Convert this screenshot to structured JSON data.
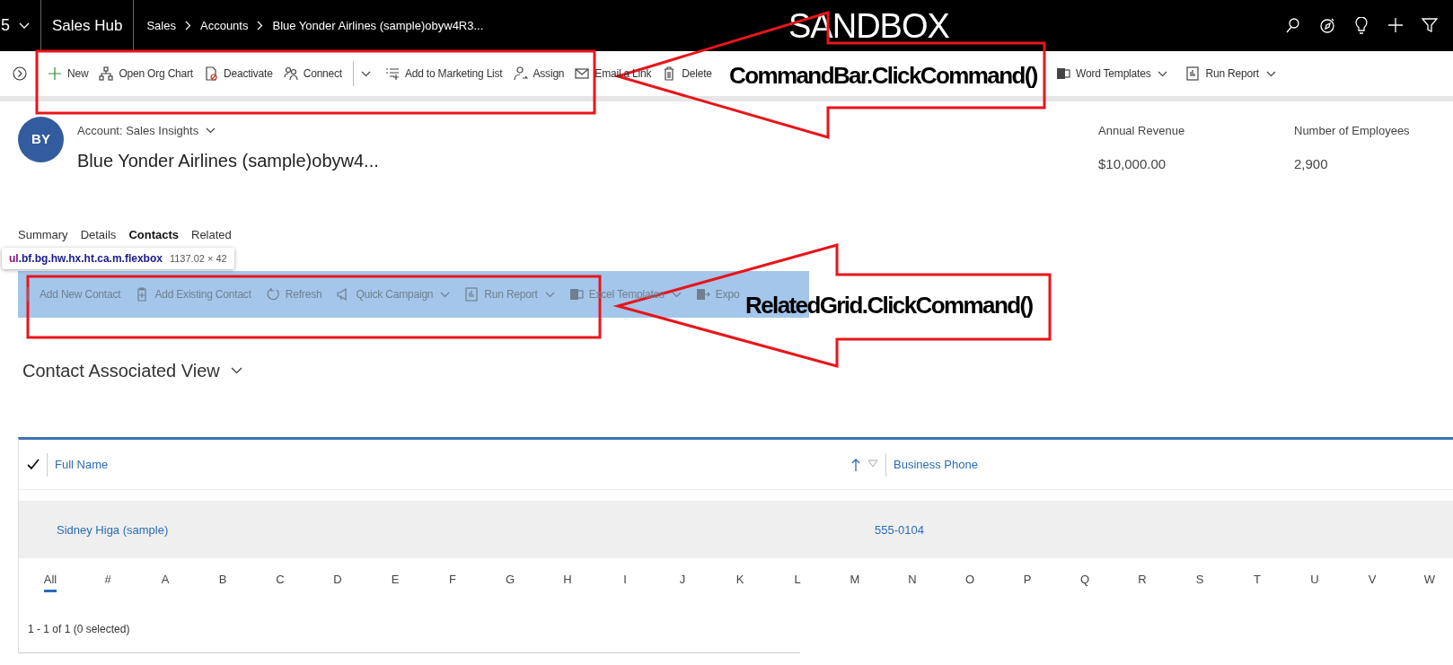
{
  "top_bar": {
    "app_switcher": "5",
    "app_name": "Sales Hub",
    "breadcrumbs": [
      "Sales",
      "Accounts",
      "Blue Yonder Airlines (sample)obyw4R3..."
    ],
    "environment": "SANDBOX"
  },
  "command_bar": {
    "items": [
      {
        "kind": "new",
        "label": "New",
        "menu": false
      },
      {
        "kind": "org-chart",
        "label": "Open Org Chart",
        "menu": false
      },
      {
        "kind": "deactivate",
        "label": "Deactivate",
        "menu": false
      },
      {
        "kind": "connect",
        "label": "Connect",
        "menu": true
      },
      {
        "kind": "marketing-list",
        "label": "Add to Marketing List",
        "menu": false
      },
      {
        "kind": "assign",
        "label": "Assign",
        "menu": false
      },
      {
        "kind": "email-link",
        "label": "Email a Link",
        "menu": false
      },
      {
        "kind": "delete",
        "label": "Delete",
        "menu": false
      },
      {
        "kind": "word",
        "label": "Word Templates",
        "menu": true
      },
      {
        "kind": "report",
        "label": "Run Report",
        "menu": true
      }
    ]
  },
  "record": {
    "initials": "BY",
    "form": "Account: Sales Insights",
    "name": "Blue Yonder Airlines (sample)obyw4...",
    "fields": [
      {
        "label": "Annual Revenue",
        "value": "$10,000.00"
      },
      {
        "label": "Number of Employees",
        "value": "2,900"
      }
    ]
  },
  "tabs": [
    {
      "label": "Summary",
      "selected": false
    },
    {
      "label": "Details",
      "selected": false
    },
    {
      "label": "Contacts",
      "selected": true
    },
    {
      "label": "Related",
      "selected": false
    }
  ],
  "inspector_tooltip": {
    "tag": "ul",
    "classes": ".bf.bg.hw.hx.ht.ca.m.flexbox",
    "size": "1137.02 × 42"
  },
  "related_grid": {
    "commands": [
      {
        "kind": "add-new",
        "label": "Add New Contact",
        "menu": false
      },
      {
        "kind": "add-existing",
        "label": "Add Existing Contact",
        "menu": false
      },
      {
        "kind": "refresh",
        "label": "Refresh",
        "menu": false
      },
      {
        "kind": "campaign",
        "label": "Quick Campaign",
        "menu": true
      },
      {
        "kind": "report",
        "label": "Run Report",
        "menu": true
      },
      {
        "kind": "excel",
        "label": "Excel Templates",
        "menu": true
      },
      {
        "kind": "export",
        "label": "Expo",
        "menu": false
      }
    ],
    "view_title": "Contact Associated View",
    "columns": [
      {
        "label": "Full Name",
        "sorted": true
      },
      {
        "label": "Business Phone",
        "sorted": false
      }
    ],
    "rows": [
      {
        "cells": [
          "Sidney Higa (sample)",
          "555-0104"
        ]
      }
    ],
    "jump_bar": [
      {
        "label": "All",
        "selected": true
      },
      {
        "label": "#",
        "selected": false
      },
      {
        "label": "A",
        "selected": false
      },
      {
        "label": "B",
        "selected": false
      },
      {
        "label": "C",
        "selected": false
      },
      {
        "label": "D",
        "selected": false
      },
      {
        "label": "E",
        "selected": false
      },
      {
        "label": "F",
        "selected": false
      },
      {
        "label": "G",
        "selected": false
      },
      {
        "label": "H",
        "selected": false
      },
      {
        "label": "I",
        "selected": false
      },
      {
        "label": "J",
        "selected": false
      },
      {
        "label": "K",
        "selected": false
      },
      {
        "label": "L",
        "selected": false
      },
      {
        "label": "M",
        "selected": false
      },
      {
        "label": "N",
        "selected": false
      },
      {
        "label": "O",
        "selected": false
      },
      {
        "label": "P",
        "selected": false
      },
      {
        "label": "Q",
        "selected": false
      },
      {
        "label": "R",
        "selected": false
      },
      {
        "label": "S",
        "selected": false
      },
      {
        "label": "T",
        "selected": false
      },
      {
        "label": "U",
        "selected": false
      },
      {
        "label": "V",
        "selected": false
      },
      {
        "label": "W",
        "selected": false
      }
    ],
    "footer": "1 - 1 of 1 (0 selected)"
  },
  "annotations": [
    {
      "text": "CommandBar.ClickCommand()"
    },
    {
      "text": "RelatedGrid.ClickCommand()"
    }
  ]
}
